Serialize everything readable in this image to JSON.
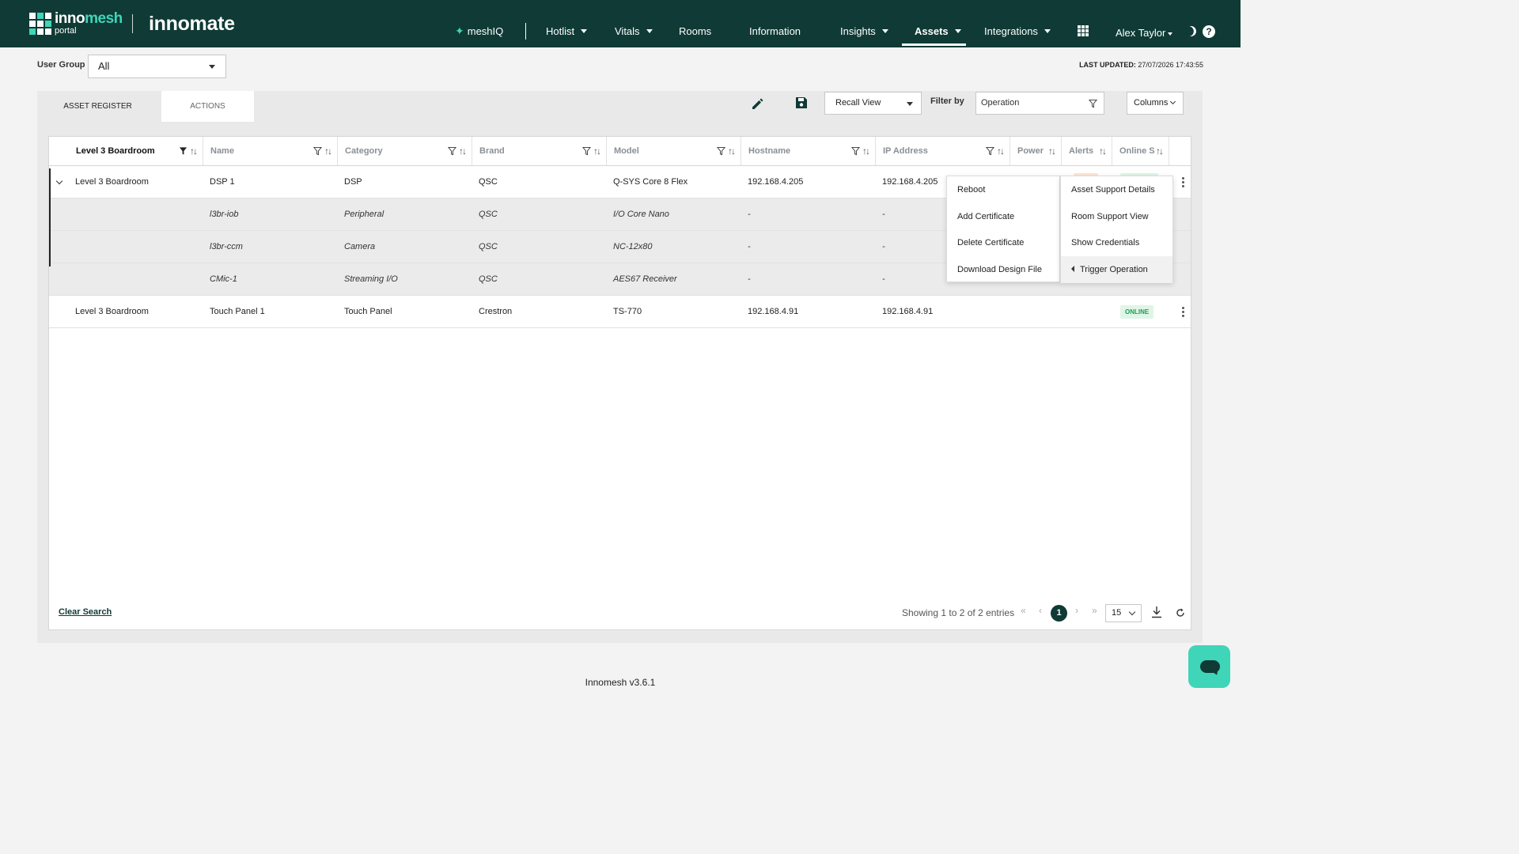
{
  "brand": {
    "logo_primary_a": "inno",
    "logo_primary_b": "mesh",
    "logo_secondary": "portal",
    "product": "innomate",
    "colors": {
      "nav_bg": "#0f3a35",
      "accent": "#3fd5b8",
      "online_green": "#1f9d55"
    }
  },
  "nav": {
    "meshiq": "meshIQ",
    "hotlist": "Hotlist",
    "vitals": "Vitals",
    "rooms": "Rooms",
    "information": "Information",
    "insights": "Insights",
    "assets": "Assets",
    "integrations": "Integrations",
    "apps_icon": "grid-icon",
    "user": "Alex Taylor",
    "theme_icon": "moon-icon",
    "help_icon": "question-icon",
    "help_glyph": "?"
  },
  "filters": {
    "user_group_label": "User Group",
    "user_group_value": "All",
    "last_updated_label": "LAST UPDATED:",
    "last_updated_value": "27/07/2026 17:43:55"
  },
  "tabs": {
    "register": "ASSET REGISTER",
    "actions": "ACTIONS"
  },
  "toolbar": {
    "recall_view": "Recall View",
    "filter_by_label": "Filter by",
    "filter_value": "Operation",
    "columns": "Columns"
  },
  "table": {
    "group_header": "Level 3 Boardroom",
    "headers": {
      "name": "Name",
      "category": "Category",
      "brand": "Brand",
      "model": "Model",
      "hostname": "Hostname",
      "ip": "IP Address",
      "power": "Power",
      "alerts": "Alerts",
      "online": "Online S"
    },
    "rows": [
      {
        "room": "Level 3 Boardroom",
        "name": "DSP 1",
        "category": "DSP",
        "brand": "QSC",
        "model": "Q-SYS Core 8 Flex",
        "hostname": "192.168.4.205",
        "ip": "192.168.4.205"
      },
      {
        "room": "",
        "name": "l3br-iob",
        "category": "Peripheral",
        "brand": "QSC",
        "model": "I/O Core Nano",
        "hostname": "-",
        "ip": "-"
      },
      {
        "room": "",
        "name": "l3br-ccm",
        "category": "Camera",
        "brand": "QSC",
        "model": "NC-12x80",
        "hostname": "-",
        "ip": "-"
      },
      {
        "room": "",
        "name": "CMic-1",
        "category": "Streaming I/O",
        "brand": "QSC",
        "model": "AES67 Receiver",
        "hostname": "-",
        "ip": "-"
      },
      {
        "room": "Level 3 Boardroom",
        "name": "Touch Panel 1",
        "category": "Touch Panel",
        "brand": "Crestron",
        "model": "TS-770",
        "hostname": "192.168.4.91",
        "ip": "192.168.4.91",
        "online": "ONLINE"
      }
    ]
  },
  "menus": {
    "operations": [
      "Reboot",
      "Add Certificate",
      "Delete Certificate",
      "Download Design File"
    ],
    "row_actions": [
      "Asset Support Details",
      "Room Support View",
      "Show Credentials",
      "Trigger Operation"
    ]
  },
  "footer": {
    "clear_search": "Clear Search",
    "showing": "Showing 1 to 2 of 2 entries",
    "page_first": "«",
    "page_prev": "‹",
    "page_current": "1",
    "page_next": "›",
    "page_last": "»",
    "page_size": "15"
  },
  "version": "Innomesh v3.6.1"
}
